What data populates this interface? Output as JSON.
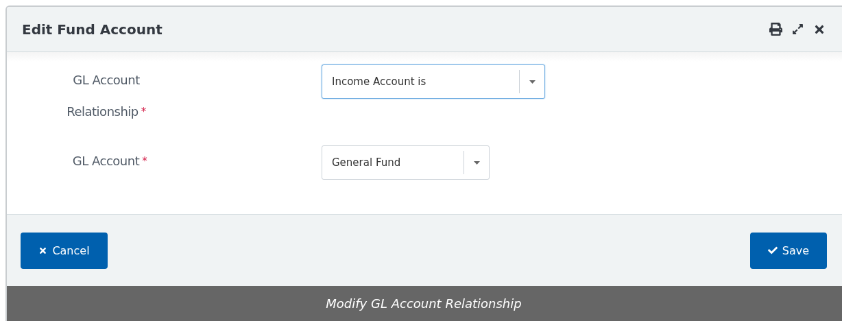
{
  "dialog": {
    "title": "Edit Fund Account",
    "fields": [
      {
        "label": "GL Account Relationship",
        "required": true,
        "required_mark": "*",
        "value": "Income Account is",
        "focused": true
      },
      {
        "label": "GL Account",
        "required": true,
        "required_mark": "*",
        "value": "General Fund",
        "focused": false
      }
    ],
    "buttons": [
      {
        "label": "Cancel",
        "kind": "cancel"
      },
      {
        "label": "Save",
        "kind": "save"
      }
    ]
  },
  "caption": "Modify GL Account Relationship"
}
